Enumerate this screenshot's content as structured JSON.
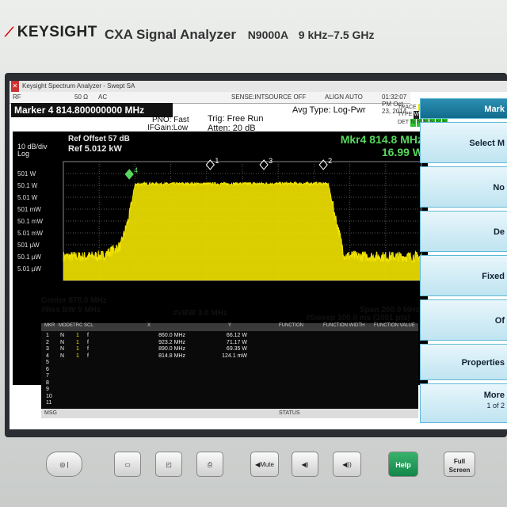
{
  "instrument": {
    "brand": "KEYSIGHT",
    "model": "CXA Signal Analyzer",
    "model_number": "N9000A",
    "freq_range": "9 kHz–7.5 GHz"
  },
  "window": {
    "title": "Keysight Spectrum Analyzer - Swept SA",
    "status_labels": [
      "RF",
      "50 Ω",
      "AC",
      "SENSE:INT",
      "SOURCE OFF",
      "ALIGN AUTO"
    ],
    "datetime": "01:32:07 PM Oct 23, 2014"
  },
  "header": {
    "marker_title": "Marker 4 814.800000000 MHz",
    "pno": "PNO: Fast",
    "ifgain": "IFGain:Low",
    "trig": "Trig: Free Run",
    "atten": "Atten: 20 dB",
    "avg_type": "Avg Type: Log-Pwr",
    "trace_label": "TRACE",
    "trace_nums": [
      "1",
      "2",
      "3",
      "4",
      "5",
      "6"
    ],
    "type_label": "TYPE",
    "type_vals": [
      "W",
      "W",
      "W",
      "W",
      "W",
      "W"
    ],
    "det_label": "DET",
    "det_vals": [
      "N",
      "N",
      "N",
      "N",
      "N",
      "N"
    ]
  },
  "graph": {
    "scale": "10 dB/div",
    "scale_type": "Log",
    "ref_offset": "Ref Offset 57 dB",
    "ref_level": "Ref 5.012 kW",
    "mkr_readout": "Mkr4 814.8 MHz",
    "mkr_value": "16.99 W",
    "y_labels": [
      "501 W",
      "50.1 W",
      "5.01 W",
      "501 mW",
      "50.1 mW",
      "5.01 mW",
      "501 µW",
      "50.1 µW",
      "5.01 µW"
    ],
    "markers": [
      "1",
      "2",
      "3",
      "4"
    ]
  },
  "footer": {
    "center": "Center 878.0 MHz",
    "res_bw": "#Res BW 5 MHz",
    "vbw": "#VBW 3.0 MHz",
    "span": "Span 200.0 MHz",
    "sweep": "#Sweep  100.0 ms (1001 pts)"
  },
  "marker_table": {
    "headers": [
      "MKR",
      "MODE",
      "TRC",
      "SCL",
      "X",
      "Y",
      "FUNCTION",
      "FUNCTION WIDTH",
      "FUNCTION VALUE"
    ],
    "rows": [
      {
        "n": "1",
        "mode": "N",
        "trc": "1",
        "scl": "f",
        "x": "860.0 MHz",
        "y": "66.12 W"
      },
      {
        "n": "2",
        "mode": "N",
        "trc": "1",
        "scl": "f",
        "x": "923.2 MHz",
        "y": "71.17 W"
      },
      {
        "n": "3",
        "mode": "N",
        "trc": "1",
        "scl": "f",
        "x": "890.0 MHz",
        "y": "69.35 W"
      },
      {
        "n": "4",
        "mode": "N",
        "trc": "1",
        "scl": "f",
        "x": "814.8 MHz",
        "y": "124.1 mW"
      },
      {
        "n": "5",
        "mode": "",
        "trc": "",
        "scl": "",
        "x": "",
        "y": ""
      },
      {
        "n": "6",
        "mode": "",
        "trc": "",
        "scl": "",
        "x": "",
        "y": ""
      },
      {
        "n": "7",
        "mode": "",
        "trc": "",
        "scl": "",
        "x": "",
        "y": ""
      },
      {
        "n": "8",
        "mode": "",
        "trc": "",
        "scl": "",
        "x": "",
        "y": ""
      },
      {
        "n": "9",
        "mode": "",
        "trc": "",
        "scl": "",
        "x": "",
        "y": ""
      },
      {
        "n": "10",
        "mode": "",
        "trc": "",
        "scl": "",
        "x": "",
        "y": ""
      },
      {
        "n": "11",
        "mode": "",
        "trc": "",
        "scl": "",
        "x": "",
        "y": ""
      }
    ],
    "status_left": "MSG",
    "status_right": "STATUS"
  },
  "softkeys": {
    "title": "Mark",
    "items": [
      {
        "label": "Select M"
      },
      {
        "label": "No"
      },
      {
        "label": "De"
      },
      {
        "label": "Fixed"
      },
      {
        "label": "Of"
      },
      {
        "label": "Properties"
      },
      {
        "label": "More",
        "sub": "1 of 2"
      }
    ]
  },
  "hardware_buttons": {
    "mute": "Mute",
    "help": "Help",
    "full_screen_1": "Full",
    "full_screen_2": "Screen"
  },
  "colors": {
    "trace": "#f2e400",
    "marker": "#56d85e",
    "graticule_bg": "#000000",
    "softkey_bg": "#cfeaf4"
  },
  "chart_data": {
    "type": "line",
    "x_axis": {
      "center_mhz": 878.0,
      "span_mhz": 200.0,
      "range_mhz": [
        778.0,
        978.0
      ]
    },
    "y_axis": {
      "ref": "5.012 kW",
      "scale_db_per_div": 10,
      "log": true
    },
    "series": [
      {
        "x_mhz": [
          778,
          790,
          800,
          810,
          814.8,
          818,
          825,
          840,
          860,
          880,
          890,
          900,
          910,
          920,
          923.2,
          926,
          930,
          935,
          950,
          978
        ],
        "level_w": [
          5e-05,
          5e-05,
          6e-05,
          0.0004,
          0.124,
          60,
          66,
          66,
          66,
          68,
          69,
          68,
          70,
          71,
          71,
          60,
          0.1,
          6e-05,
          5e-05,
          5e-05
        ]
      }
    ],
    "markers": [
      {
        "id": "1",
        "x_mhz": 860.0,
        "y": "66.12 W"
      },
      {
        "id": "2",
        "x_mhz": 923.2,
        "y": "71.17 W"
      },
      {
        "id": "3",
        "x_mhz": 890.0,
        "y": "69.35 W"
      },
      {
        "id": "4",
        "x_mhz": 814.8,
        "y": "124.1 mW"
      }
    ]
  }
}
